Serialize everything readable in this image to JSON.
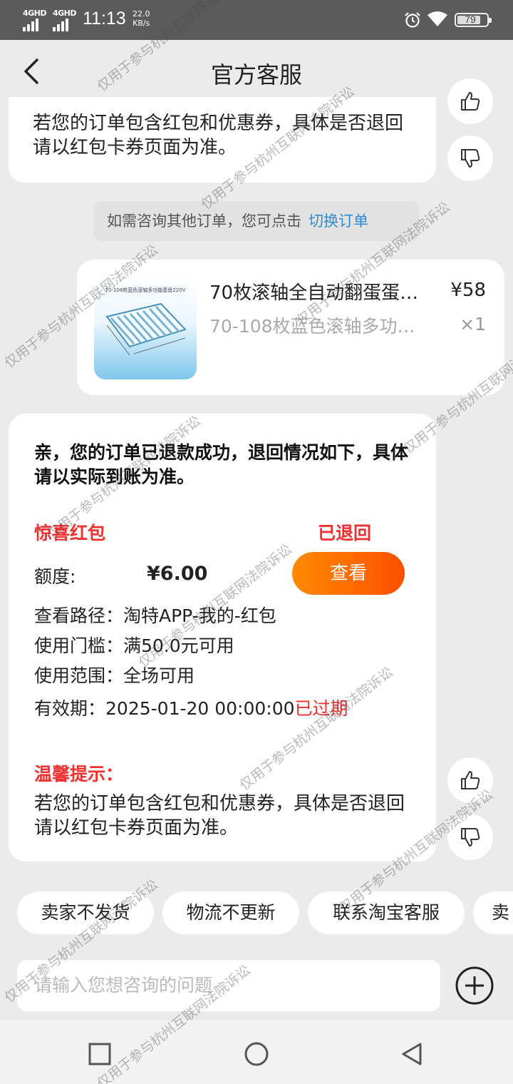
{
  "status_bar": {
    "sim1": "4GHD",
    "sim2": "4GHD",
    "time": "11:13",
    "speed_value": "22.0",
    "speed_unit": "KB/s",
    "battery": "79"
  },
  "header": {
    "title": "官方客服"
  },
  "tip_top": {
    "text": "若您的订单包含红包和优惠券，具体是否退回请以红包卡券页面为准。"
  },
  "switch_notice": {
    "text": "如需咨询其他订单，您可点击",
    "link": "切换订单"
  },
  "order_card": {
    "thumb_caption": "70-108枚蓝色滚轴多功能蛋盘220V",
    "title": "70枚滚轴全自动翻蛋蛋…",
    "price": "¥58",
    "sku": "70-108枚蓝色滚轴多功…",
    "qty": "×1"
  },
  "refund_card": {
    "headline": "亲，您的订单已退款成功，退回情况如下，具体请以实际到账为准。",
    "type": "惊喜红包",
    "status": "已退回",
    "amount_label": "额度:",
    "amount": "¥6.00",
    "view_label": "查看",
    "path": "查看路径：淘特APP-我的-红包",
    "threshold": "使用门槛：满50.0元可用",
    "scope": "使用范围：全场可用",
    "validity_label": "有效期：",
    "validity_date": "2025-01-20 00:00:00",
    "validity_status": "已过期",
    "tip_title": "温馨提示：",
    "tip_text": "若您的订单包含红包和优惠券，具体是否退回请以红包卡券页面为准。"
  },
  "quick_replies": [
    "卖家不发货",
    "物流不更新",
    "联系淘宝客服",
    "卖"
  ],
  "input": {
    "placeholder": "请输入您想咨询的问题"
  },
  "watermark": "仅用于参与杭州互联网法院诉讼",
  "colors": {
    "accent_red": "#f0312f",
    "link_blue": "#2f8ad8",
    "button_orange": "#ff6a00"
  },
  "icons": [
    "back-icon",
    "thumbs-up-icon",
    "thumbs-down-icon",
    "plus-icon",
    "alarm-icon",
    "wifi-icon",
    "battery-icon",
    "nav-recent-icon",
    "nav-home-icon",
    "nav-back-icon"
  ]
}
